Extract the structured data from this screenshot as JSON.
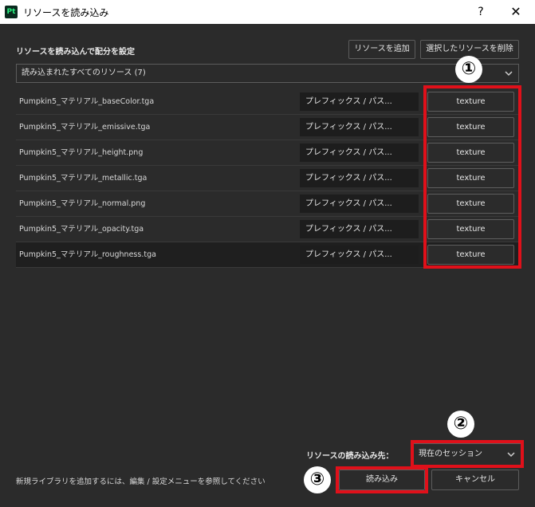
{
  "window": {
    "title": "リソースを読み込み",
    "app_icon_text": "Pt",
    "help": "?",
    "close": "✕"
  },
  "section": {
    "label": "リソースを読み込んで配分を設定"
  },
  "toolbar": {
    "add_label": "リソースを追加",
    "delete_label": "選択したリソースを削除"
  },
  "filter": {
    "value": "読み込まれたすべてのリソース (7)"
  },
  "resources": [
    {
      "file": "Pumpkin5_マテリアル_baseColor.tga",
      "dest": "プレフィックス / パス...",
      "type": "texture"
    },
    {
      "file": "Pumpkin5_マテリアル_emissive.tga",
      "dest": "プレフィックス / パス...",
      "type": "texture"
    },
    {
      "file": "Pumpkin5_マテリアル_height.png",
      "dest": "プレフィックス / パス...",
      "type": "texture"
    },
    {
      "file": "Pumpkin5_マテリアル_metallic.tga",
      "dest": "プレフィックス / パス...",
      "type": "texture"
    },
    {
      "file": "Pumpkin5_マテリアル_normal.png",
      "dest": "プレフィックス / パス...",
      "type": "texture"
    },
    {
      "file": "Pumpkin5_マテリアル_opacity.tga",
      "dest": "プレフィックス / パス...",
      "type": "texture"
    },
    {
      "file": "Pumpkin5_マテリアル_roughness.tga",
      "dest": "プレフィックス / パス...",
      "type": "texture"
    }
  ],
  "footer": {
    "dest_label": "リソースの読み込み先：",
    "dest_value": "現在のセッション",
    "hint": "新規ライブラリを追加するには、編集 / 設定メニューを参照してください",
    "import_label": "読み込み",
    "cancel_label": "キャンセル"
  },
  "annotations": {
    "badge1": "①",
    "badge2": "②",
    "badge3": "③",
    "highlight_color": "#e0101a"
  }
}
